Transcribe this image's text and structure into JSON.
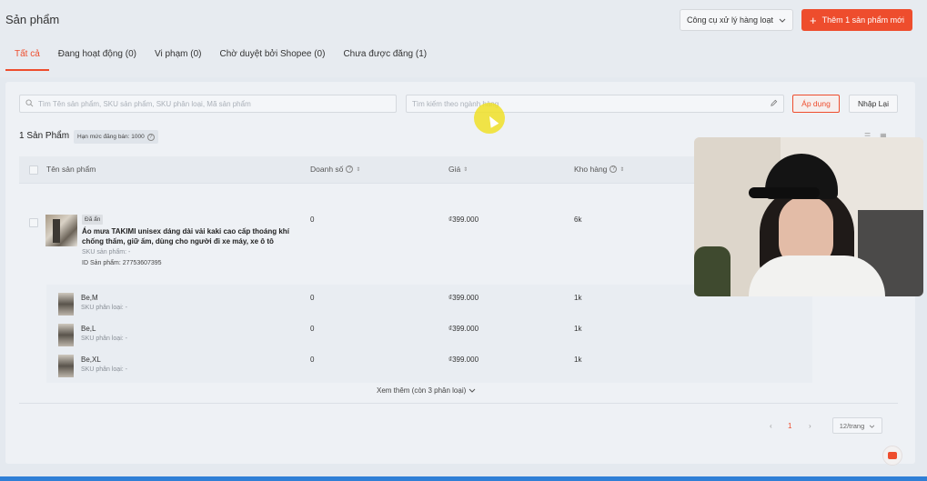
{
  "header": {
    "title": "Sản phẩm",
    "bulk_tools_label": "Công cụ xử lý hàng loạt",
    "add_product_label": "Thêm 1 sản phẩm mới"
  },
  "tabs": [
    {
      "label": "Tất cả"
    },
    {
      "label": "Đang hoạt động (0)"
    },
    {
      "label": "Vi phạm (0)"
    },
    {
      "label": "Chờ duyệt bởi Shopee (0)"
    },
    {
      "label": "Chưa được đăng (1)"
    }
  ],
  "filters": {
    "search_placeholder": "Tìm Tên sản phẩm, SKU sản phẩm, SKU phân loại, Mã sản phẩm",
    "category_placeholder": "Tìm kiếm theo ngành hàng",
    "apply_label": "Áp dụng",
    "reset_label": "Nhập Lại"
  },
  "summary": {
    "count": "1 Sản Phẩm",
    "limit": "Hạn mức đăng bán: 1000"
  },
  "table": {
    "columns": [
      "Tên sản phẩm",
      "Doanh số",
      "Giá",
      "Kho hàng"
    ],
    "product": {
      "status_badge": "Đã ẩn",
      "name": "Áo mưa TAKIMI unisex dáng dài vải kaki cao cấp thoáng khí chống thấm, giữ ấm, dùng cho người đi xe máy, xe ô tô",
      "sku": "SKU sản phẩm: -",
      "id": "ID Sản phẩm: 27753607395",
      "sales": "0",
      "price": "₫399.000",
      "stock": "6k"
    },
    "variants": [
      {
        "name": "Be,M",
        "sku": "SKU phân loại: -",
        "sales": "0",
        "price": "₫399.000",
        "stock": "1k"
      },
      {
        "name": "Be,L",
        "sku": "SKU phân loại: -",
        "sales": "0",
        "price": "₫399.000",
        "stock": "1k"
      },
      {
        "name": "Be,XL",
        "sku": "SKU phân loại: -",
        "sales": "0",
        "price": "₫399.000",
        "stock": "1k"
      }
    ],
    "see_more": "Xem thêm (còn 3 phân loại)"
  },
  "pagination": {
    "prev": "‹",
    "page": "1",
    "next": "›",
    "per_page": "12/trang"
  },
  "colors": {
    "accent": "#ee4d2d"
  }
}
